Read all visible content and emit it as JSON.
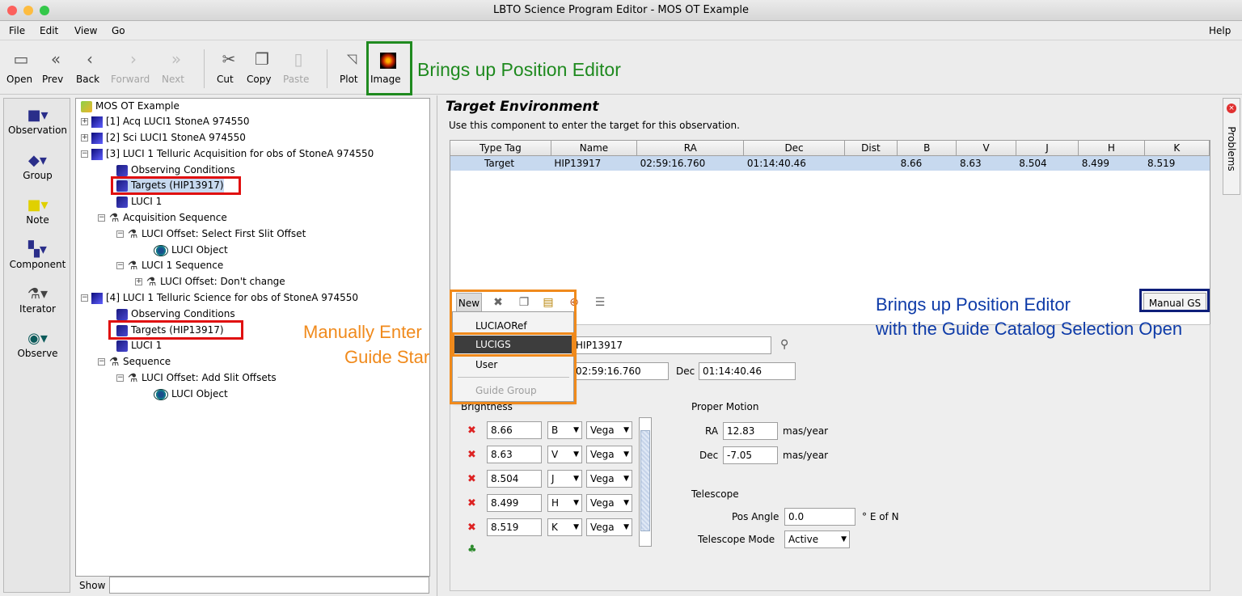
{
  "window": {
    "title": "LBTO Science Program Editor - MOS OT Example"
  },
  "menu": {
    "file": "File",
    "edit": "Edit",
    "view": "View",
    "go": "Go",
    "help": "Help"
  },
  "toolbar": {
    "open": "Open",
    "prev": "Prev",
    "back": "Back",
    "forward": "Forward",
    "next": "Next",
    "cut": "Cut",
    "copy": "Copy",
    "paste": "Paste",
    "plot": "Plot",
    "image": "Image"
  },
  "annotations": {
    "image_note": "Brings up Position Editor",
    "manual_enter_line1": "Manually Enter",
    "manual_enter_line2": "Guide Star",
    "manual_gs_line1": "Brings up Position Editor",
    "manual_gs_line2": "with the Guide Catalog Selection Open"
  },
  "palette": {
    "observation": "Observation",
    "group": "Group",
    "note": "Note",
    "component": "Component",
    "iterator": "Iterator",
    "observe": "Observe"
  },
  "tree": {
    "root": "MOS OT Example",
    "n1": "[1] Acq LUCI1 StoneA 974550",
    "n2": "[2] Sci LUCI1 StoneA 974550",
    "n3": "[3] LUCI 1 Telluric Acquisition for obs of StoneA 974550",
    "n3_cond": "Observing Conditions",
    "n3_targets": "Targets (HIP13917)",
    "n3_luci": "LUCI 1",
    "n3_acq": "Acquisition Sequence",
    "n3_offset1": "LUCI Offset: Select First Slit Offset",
    "n3_object": "LUCI Object",
    "n3_seq": "LUCI 1 Sequence",
    "n3_offset2": "LUCI Offset: Don't change",
    "n4": "[4] LUCI 1 Telluric Science for obs of StoneA 974550",
    "n4_cond": "Observing Conditions",
    "n4_targets": "Targets (HIP13917)",
    "n4_luci": "LUCI 1",
    "n4_seq": "Sequence",
    "n4_offset": "LUCI Offset: Add Slit Offsets",
    "n4_object": "LUCI Object"
  },
  "show_label": "Show",
  "target_env": {
    "title": "Target Environment",
    "desc": "Use this component to enter the target for this observation."
  },
  "table": {
    "headers": [
      "Type Tag",
      "Name",
      "RA",
      "Dec",
      "Dist",
      "B",
      "V",
      "J",
      "H",
      "K"
    ],
    "row": [
      "Target",
      "HIP13917",
      "02:59:16.760",
      "01:14:40.46",
      "",
      "8.66",
      "8.63",
      "8.504",
      "8.499",
      "8.519"
    ]
  },
  "table_toolbar": {
    "new_label": "New",
    "manual_gs": "Manual GS"
  },
  "dropdown": {
    "items": [
      "LUCIAORef",
      "LUCIGS",
      "User",
      "Guide Group"
    ]
  },
  "form": {
    "name_value": "HIP13917",
    "ra_value": "02:59:16.760",
    "dec_label": "Dec",
    "dec_value": "01:14:40.46",
    "brightness_label": "Brightness",
    "brightness": [
      {
        "value": "8.66",
        "band": "B",
        "system": "Vega"
      },
      {
        "value": "8.63",
        "band": "V",
        "system": "Vega"
      },
      {
        "value": "8.504",
        "band": "J",
        "system": "Vega"
      },
      {
        "value": "8.499",
        "band": "H",
        "system": "Vega"
      },
      {
        "value": "8.519",
        "band": "K",
        "system": "Vega"
      }
    ],
    "pm_label": "Proper Motion",
    "pm_ra_label": "RA",
    "pm_ra_value": "12.83",
    "pm_dec_label": "Dec",
    "pm_dec_value": "-7.05",
    "pm_unit": "mas/year",
    "telescope_label": "Telescope",
    "pos_angle_label": "Pos Angle",
    "pos_angle_value": "0.0",
    "pos_angle_unit": "° E of N",
    "tel_mode_label": "Telescope Mode",
    "tel_mode_value": "Active"
  },
  "side_tab": "Problems"
}
